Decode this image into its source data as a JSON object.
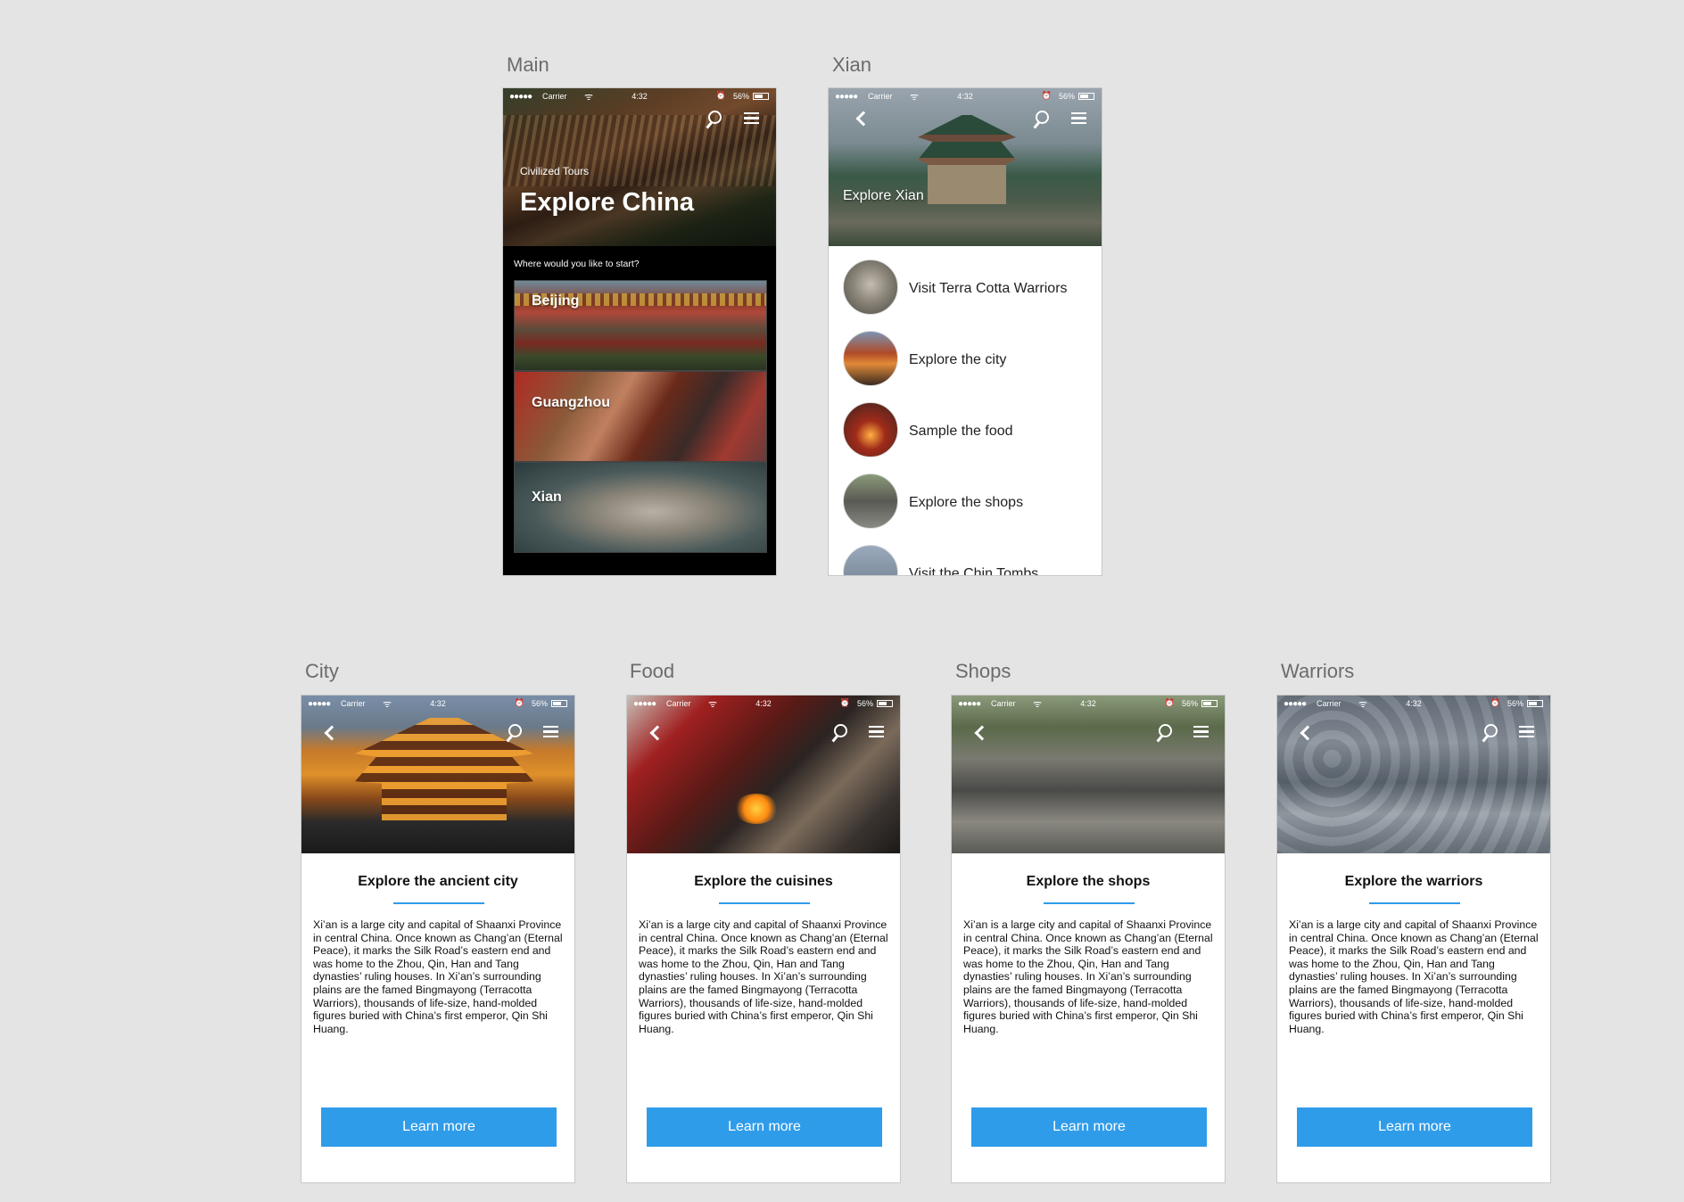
{
  "status_bar": {
    "signal": "●●●●●",
    "carrier": "Carrier",
    "wifi": "ᯤ",
    "time": "4:32",
    "alarm": "⏰",
    "battery": "56%"
  },
  "artboards": {
    "main": "Main",
    "xian": "Xian",
    "city": "City",
    "food": "Food",
    "shops": "Shops",
    "warriors": "Warriors"
  },
  "main": {
    "brand": "Civilized Tours",
    "title": "Explore China",
    "prompt": "Where would you like to start?",
    "cities": [
      "Beijing",
      "Guangzhou",
      "Xian"
    ]
  },
  "xian": {
    "title": "Explore Xian",
    "items": [
      "Visit Terra Cotta Warriors",
      "Explore the city",
      "Sample the food",
      "Explore the shops",
      "Visit the Chin Tombs"
    ]
  },
  "detail": {
    "body": "Xi’an is a large city and capital of Shaanxi Province in central China. Once known as Chang’an (Eternal Peace), it marks the Silk Road’s eastern end and was home to the Zhou, Qin, Han and Tang dynasties’ ruling houses. In Xi’an’s surrounding plains are the famed Bingmayong (Terracotta Warriors), thousands of life-size, hand-molded figures buried with China’s first emperor, Qin Shi Huang.",
    "button": "Learn more",
    "city_title": "Explore the ancient city",
    "food_title": "Explore the cuisines",
    "shops_title": "Explore the shops",
    "warriors_title": "Explore the warriors"
  },
  "colors": {
    "accent": "#2f9cea",
    "canvas": "#e4e4e4"
  },
  "icons": [
    "search-icon",
    "menu-icon",
    "back-icon"
  ]
}
